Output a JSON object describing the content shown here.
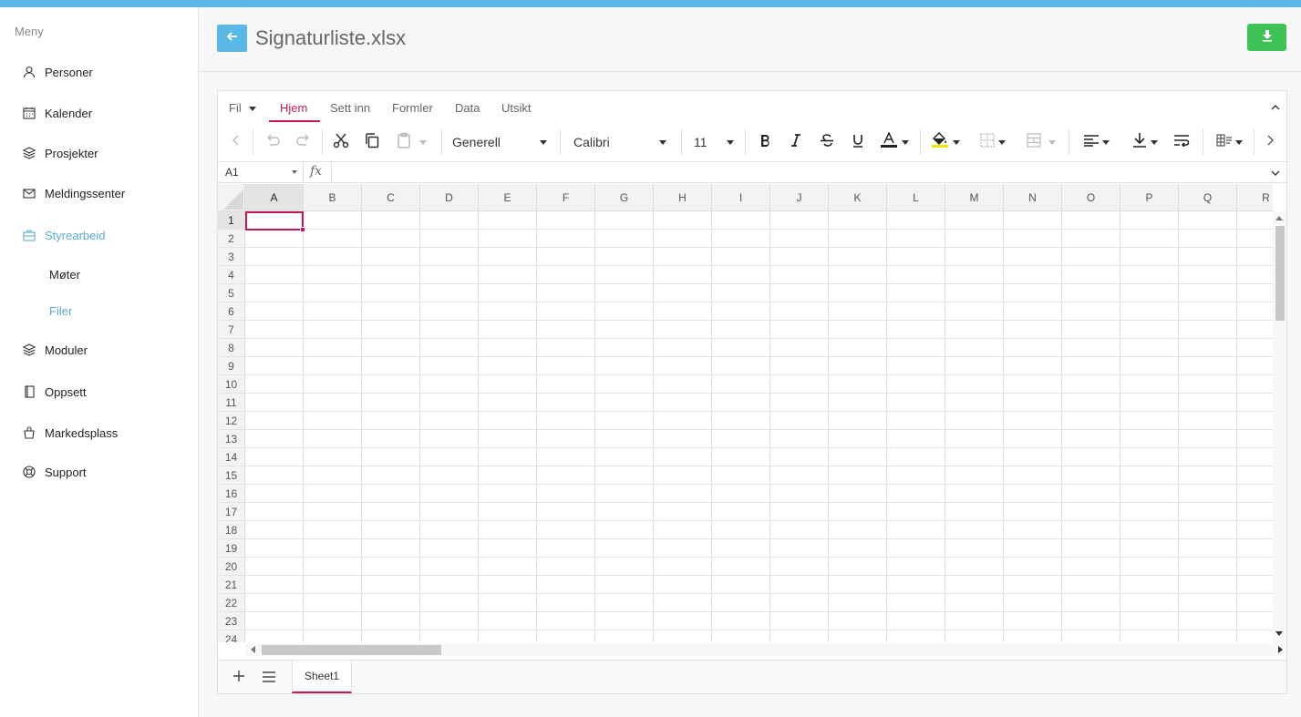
{
  "sidebar": {
    "menu_title": "Meny",
    "items": [
      {
        "label": "Personer",
        "icon": "person-icon"
      },
      {
        "label": "Kalender",
        "icon": "calendar-icon"
      },
      {
        "label": "Prosjekter",
        "icon": "layers-icon"
      },
      {
        "label": "Meldingssenter",
        "icon": "mail-icon"
      },
      {
        "label": "Styrearbeid",
        "icon": "briefcase-icon",
        "active": true
      },
      {
        "label": "Moduler",
        "icon": "layers-icon"
      },
      {
        "label": "Oppsett",
        "icon": "book-icon"
      },
      {
        "label": "Markedsplass",
        "icon": "shopping-bag-icon"
      },
      {
        "label": "Support",
        "icon": "lifebuoy-icon"
      }
    ],
    "sub_items": [
      {
        "label": "Møter"
      },
      {
        "label": "Filer",
        "active": true
      }
    ]
  },
  "header": {
    "title": "Signaturliste.xlsx"
  },
  "ribbon": {
    "tabs": [
      {
        "label": "Fil"
      },
      {
        "label": "Hjem",
        "active": true
      },
      {
        "label": "Sett inn"
      },
      {
        "label": "Formler"
      },
      {
        "label": "Data"
      },
      {
        "label": "Utsikt"
      }
    ],
    "number_format": "Generell",
    "font_name": "Calibri",
    "font_size": "11"
  },
  "formula_bar": {
    "cell_ref": "A1",
    "fx_label": "fx",
    "value": ""
  },
  "grid": {
    "columns": [
      "A",
      "B",
      "C",
      "D",
      "E",
      "F",
      "G",
      "H",
      "I",
      "J",
      "K",
      "L",
      "M",
      "N",
      "O",
      "P",
      "Q",
      "R"
    ],
    "rows": [
      "1",
      "2",
      "3",
      "4",
      "5",
      "6",
      "7",
      "8",
      "9",
      "10",
      "11",
      "12",
      "13",
      "14",
      "15",
      "16",
      "17",
      "18",
      "19",
      "20",
      "21",
      "22",
      "23",
      "24"
    ],
    "selected_cell": "A1"
  },
  "sheets": [
    {
      "label": "Sheet1",
      "active": true
    }
  ],
  "colors": {
    "accent": "#c2185b",
    "top_bar": "#5ab8e6",
    "download": "#3fc356",
    "nav_active": "#5aa9d6"
  }
}
